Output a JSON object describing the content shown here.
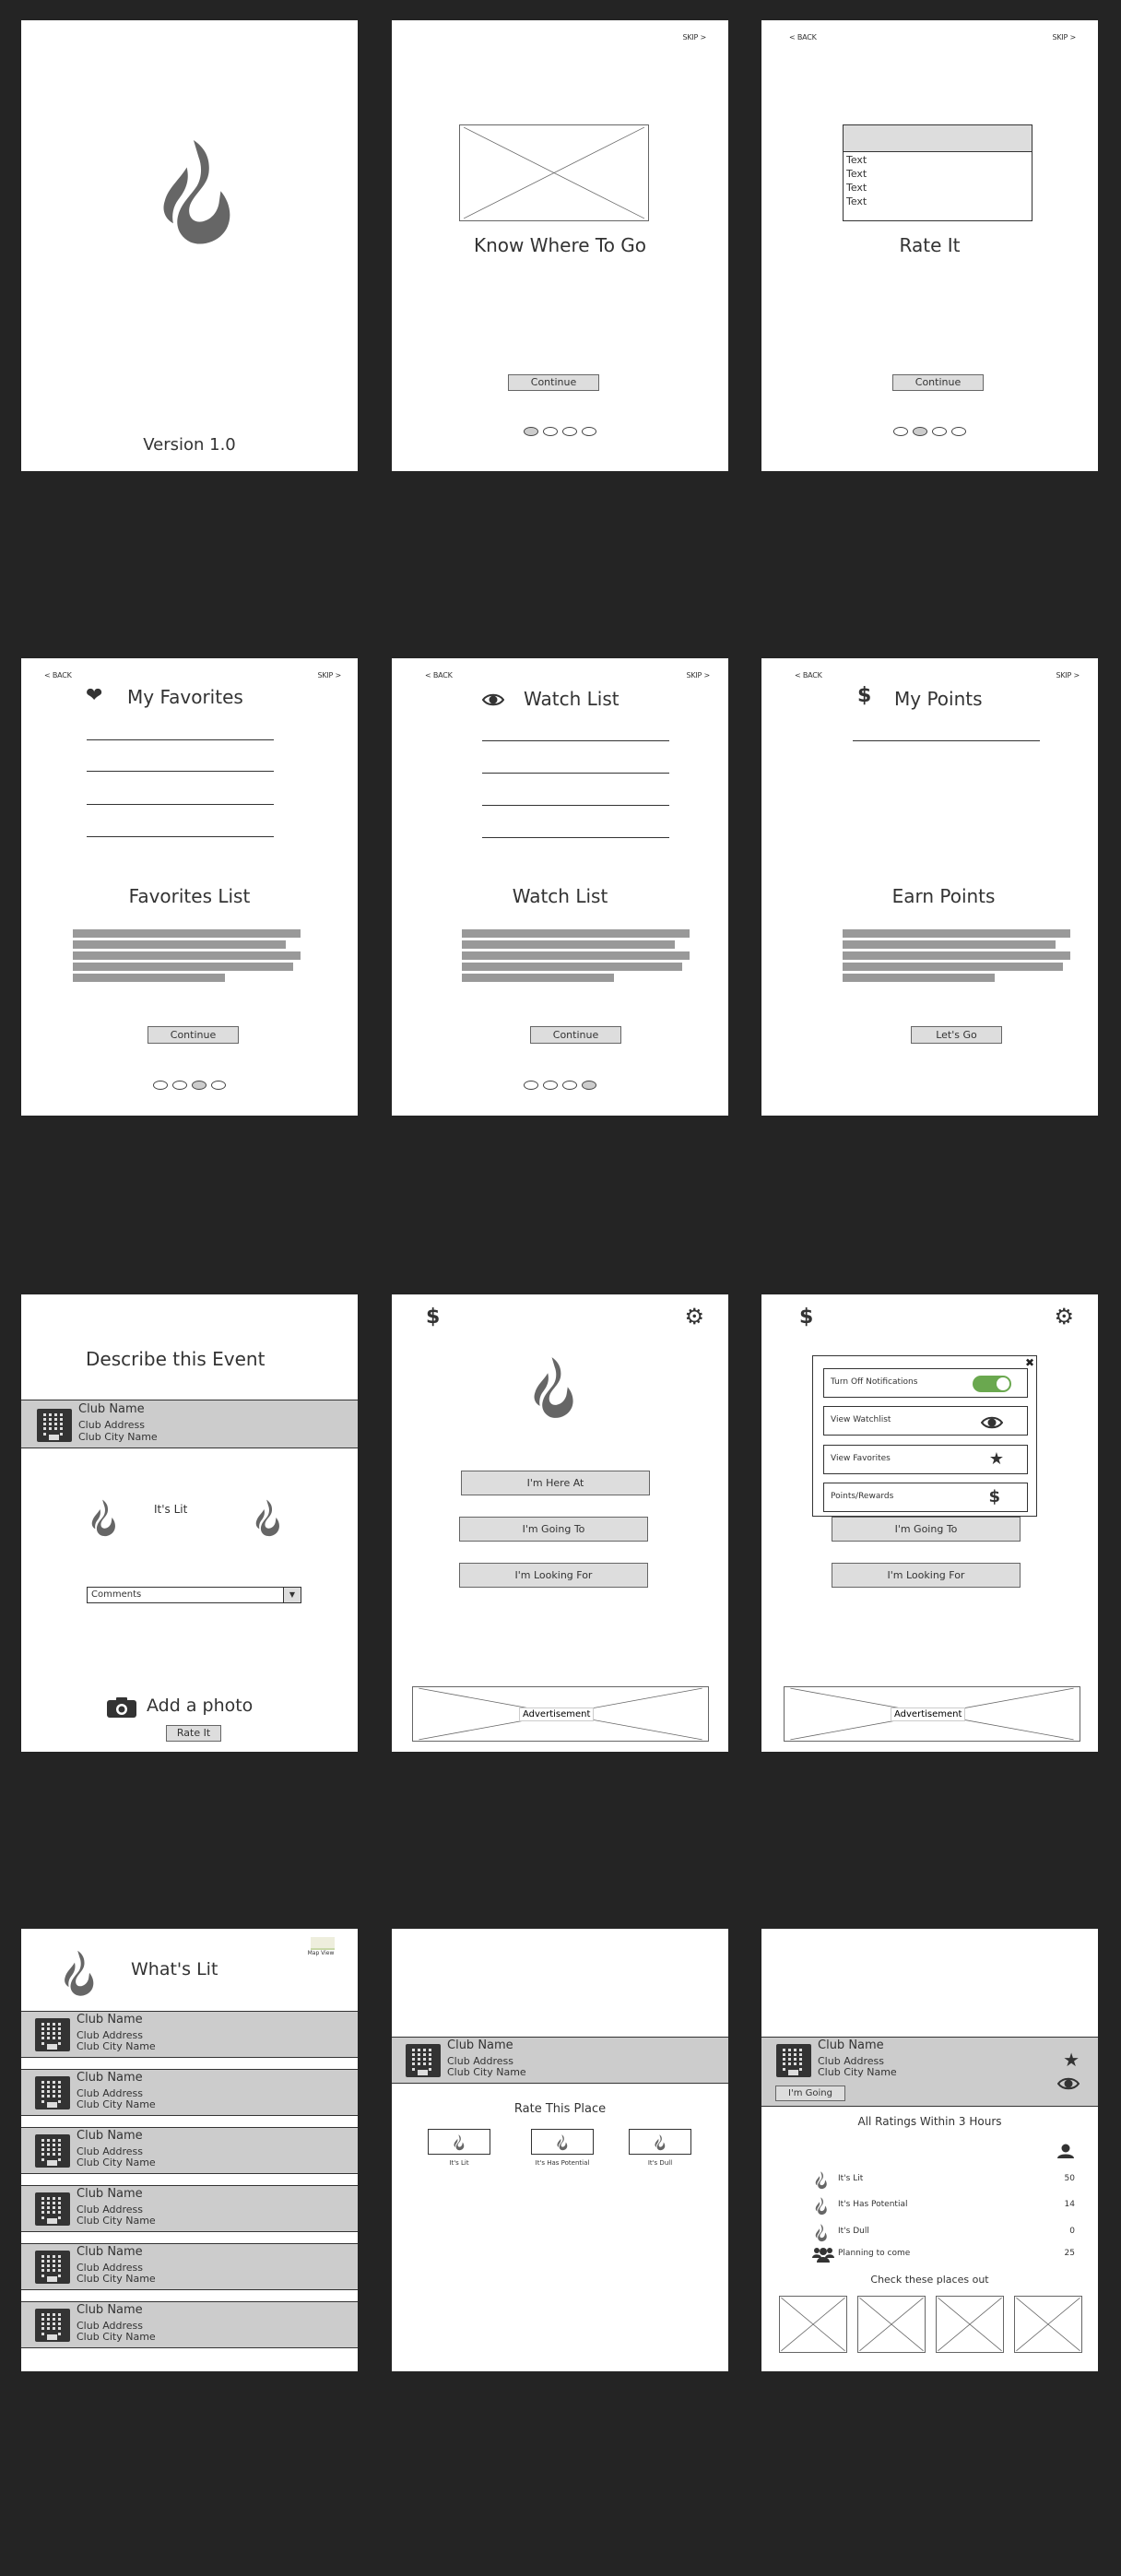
{
  "colors": {
    "background": "#242424",
    "screen": "#ffffff",
    "button": "#dddddd",
    "club_row": "#cccccc",
    "icon": "#333333",
    "flame": "#666666",
    "toggle_on": "#6aa84f"
  },
  "nav": {
    "back": "< BACK",
    "skip": "SKIP >"
  },
  "splash": {
    "version": "Version 1.0",
    "logo_icon": "flame-icon"
  },
  "onboard_know": {
    "title": "Know Where To Go",
    "continue": "Continue",
    "page": 1,
    "pages": 4
  },
  "onboard_rate": {
    "title": "Rate It",
    "list_items": [
      "Text",
      "Text",
      "Text",
      "Text"
    ],
    "continue": "Continue",
    "page": 2,
    "pages": 4
  },
  "onboard_favorites": {
    "header": "My Favorites",
    "header_icon": "heart-icon",
    "subtitle": "Favorites List",
    "continue": "Continue",
    "page": 3,
    "pages": 4
  },
  "onboard_watch": {
    "header": "Watch List",
    "header_icon": "eye-icon",
    "subtitle": "Watch List",
    "continue": "Continue",
    "page": 4,
    "pages": 4
  },
  "onboard_points": {
    "header": "My Points",
    "header_icon": "dollar-icon",
    "subtitle": "Earn Points",
    "button": "Let's Go"
  },
  "club": {
    "name": "Club Name",
    "address": "Club Address",
    "city": "Club City Name"
  },
  "describe": {
    "title": "Describe this Event",
    "rating_label": "It's Lit",
    "comments": "Comments",
    "add_photo": "Add a photo",
    "rate_button": "Rate It"
  },
  "home": {
    "buttons": [
      "I'm Here At",
      "I'm Going To",
      "I'm Looking For"
    ],
    "ad": "Advertisement"
  },
  "settings_menu": {
    "items": [
      {
        "label": "Turn Off Notifications",
        "icon": "toggle-on",
        "toggle": true
      },
      {
        "label": "View Watchlist",
        "icon": "eye-icon"
      },
      {
        "label": "View Favorites",
        "icon": "star-icon"
      },
      {
        "label": "Points/Rewards",
        "icon": "dollar-icon"
      }
    ],
    "buttons": [
      "I'm Going To",
      "I'm Looking For"
    ],
    "ad": "Advertisement"
  },
  "whats_lit": {
    "title": "What's Lit",
    "map_view": "Map View",
    "count": 6
  },
  "rate_place": {
    "title": "Rate This Place",
    "options": [
      "It's Lit",
      "It's Has Potential",
      "It's Dull"
    ]
  },
  "club_detail": {
    "going_button": "I'm Going",
    "ratings_title": "All Ratings Within 3 Hours",
    "stats": [
      {
        "label": "It's Lit",
        "value": "50",
        "icon": "flame-icon"
      },
      {
        "label": "It's Has Potential",
        "value": "14",
        "icon": "flame-icon"
      },
      {
        "label": "It's Dull",
        "value": "0",
        "icon": "flame-icon"
      },
      {
        "label": "Planning to come",
        "value": "25",
        "icon": "group-icon"
      }
    ],
    "suggest_title": "Check these places out",
    "suggest_count": 4
  }
}
